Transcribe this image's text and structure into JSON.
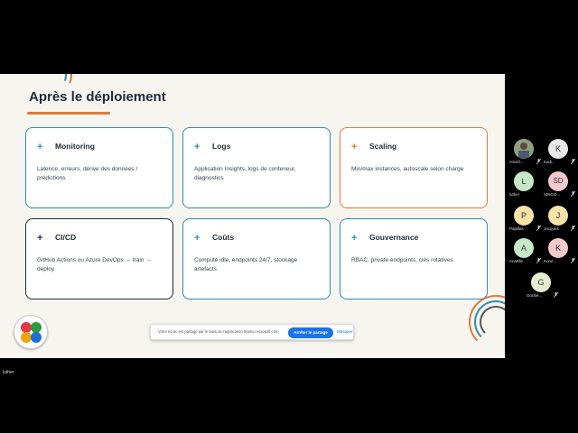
{
  "slide": {
    "title": "Après le déploiement",
    "cards": [
      {
        "plus": "+",
        "title": "Monitoring",
        "desc": "Latence, erreurs, dérive des données / prédictions"
      },
      {
        "plus": "+",
        "title": "Logs",
        "desc": "Application Insights, logs de conteneur, diagnostics"
      },
      {
        "plus": "+",
        "title": "Scaling",
        "desc": "Min/max instances, autoscale selon charge"
      },
      {
        "plus": "+",
        "title": "CI/CD",
        "desc": "GitHub Actions ou Azure DevOps → train → deploy"
      },
      {
        "plus": "+",
        "title": "Coûts",
        "desc": "Compute idle, endpoints 24/7, stockage artefacts"
      },
      {
        "plus": "+",
        "title": "Gouvernance",
        "desc": "RBAC, private endpoints, clés rotatives"
      }
    ]
  },
  "share_bar": {
    "message": "Votre écran est partagé par le biais de l'application teams.microsoft.com.",
    "stop_label": "Arrêter le partage",
    "hide_label": "Masquer"
  },
  "presenter": "luther",
  "participants": [
    {
      "initial": "",
      "name": "ASSO...",
      "color": "#7a8a70",
      "photo": true
    },
    {
      "initial": "K",
      "name": "Kedi...",
      "color": "#e8e8e8"
    },
    {
      "initial": "L",
      "name": "luther",
      "color": "#c6e8c6"
    },
    {
      "initial": "SD",
      "name": "SINGO...",
      "color": "#f3c9cc"
    },
    {
      "initial": "P",
      "name": "Papillas",
      "color": "#f6e3a8"
    },
    {
      "initial": "J",
      "name": "Jacques",
      "color": "#f6e3a8"
    },
    {
      "initial": "A",
      "name": "Anaëlle",
      "color": "#c6e8c6"
    },
    {
      "initial": "K",
      "name": "Koné...",
      "color": "#f3c9cc"
    },
    {
      "initial": "G",
      "name": "Gonbé...",
      "color": "#e6eed0"
    }
  ]
}
